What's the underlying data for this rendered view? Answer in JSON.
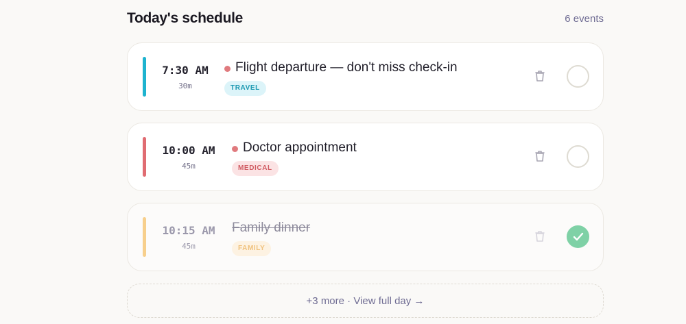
{
  "header": {
    "title": "Today's schedule",
    "count": "6 events"
  },
  "events": [
    {
      "time": "7:30 AM",
      "duration": "30m",
      "title": "Flight departure — don't miss check-in",
      "tag": "TRAVEL",
      "bar_color": "#1eb3cf",
      "tag_bg": "#dcf4f9",
      "tag_color": "#1b98b1",
      "completed": false
    },
    {
      "time": "10:00 AM",
      "duration": "45m",
      "title": "Doctor appointment",
      "tag": "MEDICAL",
      "bar_color": "#e06c72",
      "tag_bg": "#fbe3e4",
      "tag_color": "#d05b62",
      "completed": false
    },
    {
      "time": "10:15 AM",
      "duration": "45m",
      "title": "Family dinner",
      "tag": "FAMILY",
      "bar_color": "#f7cf8c",
      "tag_bg": "#fdf2e2",
      "tag_color": "#f0c17d",
      "completed": true
    }
  ],
  "footer": {
    "more_label": "+3 more · View full day →"
  }
}
